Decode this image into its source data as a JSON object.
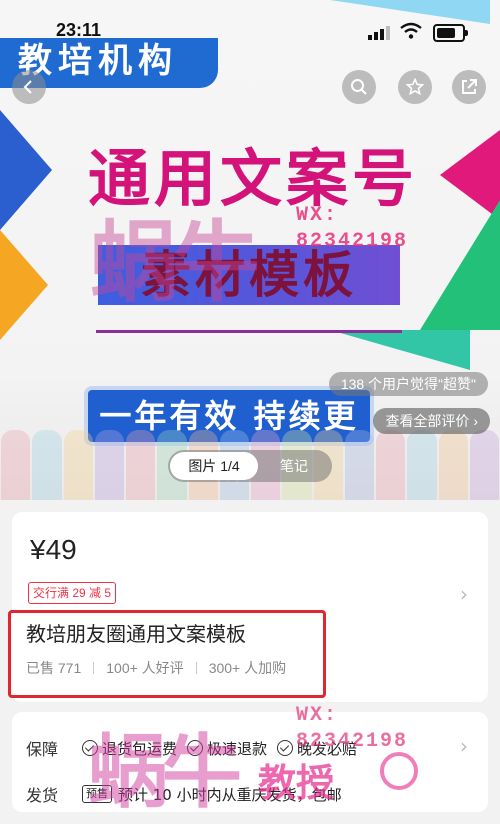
{
  "status_bar": {
    "time": "23:11"
  },
  "hero": {
    "brand": "教培机构",
    "headline": "通用文案号",
    "subheadline": "素材模板",
    "slogan": "一年有效 持续更新",
    "watermark_big": "蜗牛",
    "watermark_wx": "WX:",
    "watermark_number": "82342198",
    "rating_text": "138 个用户觉得\"超赞\"",
    "reviews_link": "查看全部评价",
    "tabs": {
      "images": "图片 1/4",
      "notes": "笔记"
    }
  },
  "product": {
    "price": "¥49",
    "promo_badge": "交行满 29 减 5",
    "title": "教培朋友圈通用文案模板",
    "stats": {
      "sold": "已售 771",
      "good_reviews": "100+ 人好评",
      "added_to_cart": "300+ 人加购"
    }
  },
  "services": {
    "guarantee_label": "保障",
    "guarantee_items": [
      "退货包运费",
      "极速退款",
      "晚发必赔"
    ],
    "shipping_label": "发货",
    "presale_badge": "预售",
    "shipping_text": "预计 10 小时内从重庆发货，包邮"
  },
  "watermark2": {
    "big": "蜗牛",
    "wx": "WX:",
    "number": "82342198",
    "sub": "教授"
  },
  "colors": {
    "accent": "#d4137a",
    "brand_blue": "#1f6bd2",
    "promo_red": "#ee3344",
    "highlight_red": "#e0262e"
  },
  "icons": [
    "back-icon",
    "search-icon",
    "star-icon",
    "share-icon",
    "chevron-right-icon",
    "check-circle-icon",
    "signal-icon",
    "wifi-icon",
    "battery-icon"
  ]
}
